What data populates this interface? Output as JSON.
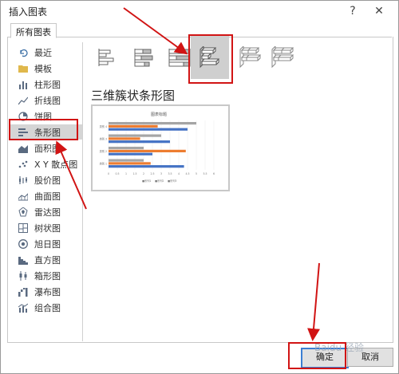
{
  "dialog": {
    "title": "插入图表",
    "help_label": "?",
    "close_label": "✕",
    "tab_label": "所有图表"
  },
  "sidebar": {
    "items": [
      {
        "label": "最近",
        "icon": "undo-arrow-icon"
      },
      {
        "label": "模板",
        "icon": "folder-icon"
      },
      {
        "label": "柱形图",
        "icon": "column-chart-icon"
      },
      {
        "label": "折线图",
        "icon": "line-chart-icon"
      },
      {
        "label": "饼图",
        "icon": "pie-chart-icon"
      },
      {
        "label": "条形图",
        "icon": "bar-chart-icon",
        "selected": true
      },
      {
        "label": "面积图",
        "icon": "area-chart-icon"
      },
      {
        "label": "X Y 散点图",
        "icon": "scatter-chart-icon"
      },
      {
        "label": "股价图",
        "icon": "stock-chart-icon"
      },
      {
        "label": "曲面图",
        "icon": "surface-chart-icon"
      },
      {
        "label": "雷达图",
        "icon": "radar-chart-icon"
      },
      {
        "label": "树状图",
        "icon": "treemap-chart-icon"
      },
      {
        "label": "旭日图",
        "icon": "sunburst-chart-icon"
      },
      {
        "label": "直方图",
        "icon": "histogram-chart-icon"
      },
      {
        "label": "箱形图",
        "icon": "box-whisker-chart-icon"
      },
      {
        "label": "瀑布图",
        "icon": "waterfall-chart-icon"
      },
      {
        "label": "组合图",
        "icon": "combo-chart-icon"
      }
    ]
  },
  "subtypes": {
    "selected_index": 3,
    "selected_title": "三维簇状条形图"
  },
  "preview": {
    "chart_title": "图表标题",
    "categories": [
      "类别 4",
      "类别 3",
      "类别 2",
      "类别 1"
    ],
    "series": [
      {
        "name": "系列1",
        "color": "#4472c4",
        "values": [
          4.5,
          3.5,
          2.5,
          4.3
        ]
      },
      {
        "name": "系列2",
        "color": "#ed7d31",
        "values": [
          2.8,
          1.8,
          4.4,
          2.4
        ]
      },
      {
        "name": "系列3",
        "color": "#a5a5a5",
        "values": [
          5.0,
          3.0,
          2.0,
          2.0
        ]
      }
    ],
    "x_ticks": [
      "0",
      "0.5",
      "1",
      "1.5",
      "2",
      "2.5",
      "3",
      "3.5",
      "4",
      "4.5",
      "5",
      "5.5",
      "6"
    ],
    "legend": [
      "■系列1",
      "■系列2",
      "■系列3"
    ]
  },
  "buttons": {
    "ok_label": "确定",
    "cancel_label": "取消"
  },
  "watermark": "Baidu 经验",
  "colors": {
    "accent_red": "#d11414",
    "selection_gray": "#d5d5d5",
    "ok_border_blue": "#3c7fd3"
  }
}
